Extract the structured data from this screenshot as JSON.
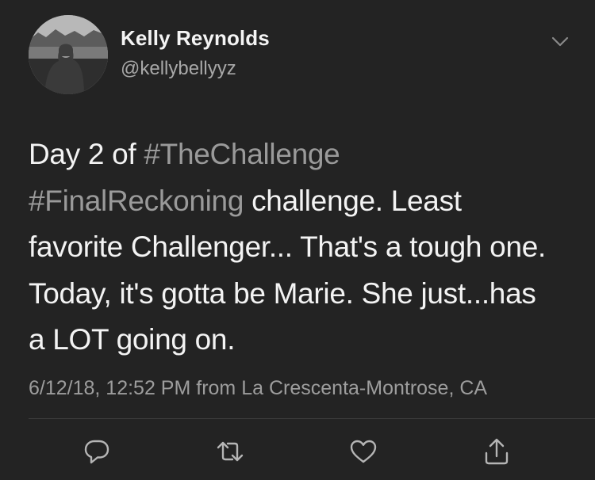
{
  "author": {
    "name": "Kelly Reynolds",
    "handle": "@kellybellyyz"
  },
  "tweet": {
    "lines": [
      [
        {
          "text": "Day 2 of ",
          "type": "text"
        },
        {
          "text": "#TheChallenge",
          "type": "hashtag"
        }
      ],
      [
        {
          "text": "#FinalReckoning",
          "type": "hashtag"
        },
        {
          "text": " challenge. Least",
          "type": "text"
        }
      ],
      [
        {
          "text": "favorite Challenger... That's a tough one.",
          "type": "text"
        }
      ],
      [
        {
          "text": "Today, it's gotta be Marie. She just...has",
          "type": "text"
        }
      ],
      [
        {
          "text": "a LOT going on.",
          "type": "text"
        }
      ]
    ]
  },
  "meta": {
    "timestamp": "6/12/18, 12:52 PM",
    "from_label": " from ",
    "location": "La Crescenta-Montrose, CA"
  },
  "actions": {
    "icons": [
      "reply-icon",
      "retweet-icon",
      "like-icon",
      "share-icon"
    ]
  },
  "colors": {
    "background": "#232323",
    "text": "#f3f3f3",
    "hashtag": "#9a9a9a",
    "secondary": "#9d9d9d",
    "icon": "#b5b5b5"
  }
}
